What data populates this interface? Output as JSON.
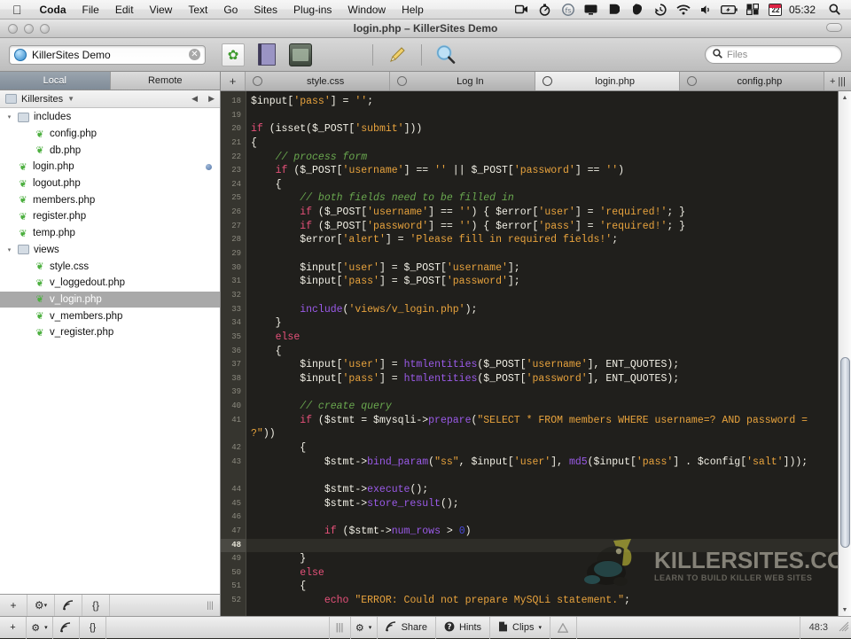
{
  "menubar": {
    "apple_icon": "apple-icon",
    "items": [
      {
        "label": "Coda",
        "bold": true
      },
      {
        "label": "File"
      },
      {
        "label": "Edit"
      },
      {
        "label": "View"
      },
      {
        "label": "Text"
      },
      {
        "label": "Go"
      },
      {
        "label": "Sites"
      },
      {
        "label": "Plug-ins"
      },
      {
        "label": "Window"
      },
      {
        "label": "Help"
      }
    ],
    "status_icons": [
      "screen-record-icon",
      "stopwatch-icon",
      "fastscripts-icon",
      "display-icon",
      "dropbox-icon",
      "evernote-icon",
      "time-machine-icon",
      "wifi-icon",
      "volume-icon",
      "battery-icon",
      "cloud-sync-icon"
    ],
    "date_badge": "22",
    "clock": "05:32",
    "spotlight_icon": "search-icon"
  },
  "window": {
    "title": "login.php – KillerSites Demo"
  },
  "toolbar": {
    "site_name": "KillerSites Demo",
    "clear_glyph": "✕",
    "icons": [
      "leaf-page-icon",
      "book-icon",
      "terminal-icon",
      "pencil-icon",
      "preview-magnifier-icon"
    ],
    "search_placeholder": "Files",
    "search_value": ""
  },
  "sidebar": {
    "tabs": [
      {
        "label": "Local",
        "active": true
      },
      {
        "label": "Remote",
        "active": false
      }
    ],
    "path_label": "Killersites",
    "nav_back": "◀",
    "nav_forward": "▶",
    "files": [
      {
        "label": "includes",
        "type": "folder",
        "indent": 0,
        "twisty": "▾",
        "selected": false,
        "dot": false
      },
      {
        "label": "config.php",
        "type": "php",
        "indent": 1,
        "twisty": "",
        "selected": false,
        "dot": false
      },
      {
        "label": "db.php",
        "type": "php",
        "indent": 1,
        "twisty": "",
        "selected": false,
        "dot": false
      },
      {
        "label": "login.php",
        "type": "php",
        "indent": 0,
        "twisty": "",
        "selected": false,
        "dot": true
      },
      {
        "label": "logout.php",
        "type": "php",
        "indent": 0,
        "twisty": "",
        "selected": false,
        "dot": false
      },
      {
        "label": "members.php",
        "type": "php",
        "indent": 0,
        "twisty": "",
        "selected": false,
        "dot": false
      },
      {
        "label": "register.php",
        "type": "php",
        "indent": 0,
        "twisty": "",
        "selected": false,
        "dot": false
      },
      {
        "label": "temp.php",
        "type": "php",
        "indent": 0,
        "twisty": "",
        "selected": false,
        "dot": false
      },
      {
        "label": "views",
        "type": "folder",
        "indent": 0,
        "twisty": "▾",
        "selected": false,
        "dot": false
      },
      {
        "label": "style.css",
        "type": "php",
        "indent": 1,
        "twisty": "",
        "selected": false,
        "dot": false
      },
      {
        "label": "v_loggedout.php",
        "type": "php",
        "indent": 1,
        "twisty": "",
        "selected": false,
        "dot": false
      },
      {
        "label": "v_login.php",
        "type": "php",
        "indent": 1,
        "twisty": "",
        "selected": true,
        "dot": false
      },
      {
        "label": "v_members.php",
        "type": "php",
        "indent": 1,
        "twisty": "",
        "selected": false,
        "dot": false
      },
      {
        "label": "v_register.php",
        "type": "php",
        "indent": 1,
        "twisty": "",
        "selected": false,
        "dot": false
      }
    ],
    "bottom_buttons": [
      "add-icon",
      "gear-icon",
      "publish-icon",
      "code-braces-icon"
    ]
  },
  "editor": {
    "new_tab_label": "+",
    "tabs": [
      {
        "label": "style.css",
        "active": false
      },
      {
        "label": "Log In",
        "active": false
      },
      {
        "label": "login.php",
        "active": true
      },
      {
        "label": "config.php",
        "active": false
      }
    ],
    "tab_add_label": "+",
    "tab_list_label": "|||",
    "current_line": 48,
    "lines": [
      {
        "n": 18,
        "tokens": [
          {
            "t": "$input[",
            "c": "var"
          },
          {
            "t": "'pass'",
            "c": "str"
          },
          {
            "t": "] = ",
            "c": "var"
          },
          {
            "t": "''",
            "c": "str"
          },
          {
            "t": ";",
            "c": "var"
          }
        ]
      },
      {
        "n": 19,
        "tokens": []
      },
      {
        "n": 20,
        "tokens": [
          {
            "t": "if",
            "c": "kw"
          },
          {
            "t": " (isset($_POST[",
            "c": "var"
          },
          {
            "t": "'submit'",
            "c": "str"
          },
          {
            "t": "]))",
            "c": "var"
          }
        ]
      },
      {
        "n": 21,
        "tokens": [
          {
            "t": "{",
            "c": "var"
          }
        ]
      },
      {
        "n": 22,
        "tokens": [
          {
            "t": "    // process form",
            "c": "com"
          }
        ]
      },
      {
        "n": 23,
        "tokens": [
          {
            "t": "    ",
            "c": "var"
          },
          {
            "t": "if",
            "c": "kw"
          },
          {
            "t": " ($_POST[",
            "c": "var"
          },
          {
            "t": "'username'",
            "c": "str"
          },
          {
            "t": "] == ",
            "c": "var"
          },
          {
            "t": "''",
            "c": "str"
          },
          {
            "t": " || $_POST[",
            "c": "var"
          },
          {
            "t": "'password'",
            "c": "str"
          },
          {
            "t": "] == ",
            "c": "var"
          },
          {
            "t": "''",
            "c": "str"
          },
          {
            "t": ")",
            "c": "var"
          }
        ]
      },
      {
        "n": 24,
        "tokens": [
          {
            "t": "    {",
            "c": "var"
          }
        ]
      },
      {
        "n": 25,
        "tokens": [
          {
            "t": "        // both fields need to be filled in",
            "c": "com"
          }
        ]
      },
      {
        "n": 26,
        "tokens": [
          {
            "t": "        ",
            "c": "var"
          },
          {
            "t": "if",
            "c": "kw"
          },
          {
            "t": " ($_POST[",
            "c": "var"
          },
          {
            "t": "'username'",
            "c": "str"
          },
          {
            "t": "] == ",
            "c": "var"
          },
          {
            "t": "''",
            "c": "str"
          },
          {
            "t": ") { $error[",
            "c": "var"
          },
          {
            "t": "'user'",
            "c": "str"
          },
          {
            "t": "] = ",
            "c": "var"
          },
          {
            "t": "'required!'",
            "c": "str"
          },
          {
            "t": "; }",
            "c": "var"
          }
        ]
      },
      {
        "n": 27,
        "tokens": [
          {
            "t": "        ",
            "c": "var"
          },
          {
            "t": "if",
            "c": "kw"
          },
          {
            "t": " ($_POST[",
            "c": "var"
          },
          {
            "t": "'password'",
            "c": "str"
          },
          {
            "t": "] == ",
            "c": "var"
          },
          {
            "t": "''",
            "c": "str"
          },
          {
            "t": ") { $error[",
            "c": "var"
          },
          {
            "t": "'pass'",
            "c": "str"
          },
          {
            "t": "] = ",
            "c": "var"
          },
          {
            "t": "'required!'",
            "c": "str"
          },
          {
            "t": "; }",
            "c": "var"
          }
        ]
      },
      {
        "n": 28,
        "tokens": [
          {
            "t": "        $error[",
            "c": "var"
          },
          {
            "t": "'alert'",
            "c": "str"
          },
          {
            "t": "] = ",
            "c": "var"
          },
          {
            "t": "'Please fill in required fields!'",
            "c": "str"
          },
          {
            "t": ";",
            "c": "var"
          }
        ]
      },
      {
        "n": 29,
        "tokens": []
      },
      {
        "n": 30,
        "tokens": [
          {
            "t": "        $input[",
            "c": "var"
          },
          {
            "t": "'user'",
            "c": "str"
          },
          {
            "t": "] = $_POST[",
            "c": "var"
          },
          {
            "t": "'username'",
            "c": "str"
          },
          {
            "t": "];",
            "c": "var"
          }
        ]
      },
      {
        "n": 31,
        "tokens": [
          {
            "t": "        $input[",
            "c": "var"
          },
          {
            "t": "'pass'",
            "c": "str"
          },
          {
            "t": "] = $_POST[",
            "c": "var"
          },
          {
            "t": "'password'",
            "c": "str"
          },
          {
            "t": "];",
            "c": "var"
          }
        ]
      },
      {
        "n": 32,
        "tokens": []
      },
      {
        "n": 33,
        "tokens": [
          {
            "t": "        ",
            "c": "var"
          },
          {
            "t": "include",
            "c": "fn"
          },
          {
            "t": "(",
            "c": "var"
          },
          {
            "t": "'views/v_login.php'",
            "c": "str"
          },
          {
            "t": ");",
            "c": "var"
          }
        ]
      },
      {
        "n": 34,
        "tokens": [
          {
            "t": "    }",
            "c": "var"
          }
        ]
      },
      {
        "n": 35,
        "tokens": [
          {
            "t": "    ",
            "c": "var"
          },
          {
            "t": "else",
            "c": "kw"
          }
        ]
      },
      {
        "n": 36,
        "tokens": [
          {
            "t": "    {",
            "c": "var"
          }
        ]
      },
      {
        "n": 37,
        "tokens": [
          {
            "t": "        $input[",
            "c": "var"
          },
          {
            "t": "'user'",
            "c": "str"
          },
          {
            "t": "] = ",
            "c": "var"
          },
          {
            "t": "htmlentities",
            "c": "fn"
          },
          {
            "t": "($_POST[",
            "c": "var"
          },
          {
            "t": "'username'",
            "c": "str"
          },
          {
            "t": "], ENT_QUOTES);",
            "c": "var"
          }
        ]
      },
      {
        "n": 38,
        "tokens": [
          {
            "t": "        $input[",
            "c": "var"
          },
          {
            "t": "'pass'",
            "c": "str"
          },
          {
            "t": "] = ",
            "c": "var"
          },
          {
            "t": "htmlentities",
            "c": "fn"
          },
          {
            "t": "($_POST[",
            "c": "var"
          },
          {
            "t": "'password'",
            "c": "str"
          },
          {
            "t": "], ENT_QUOTES);",
            "c": "var"
          }
        ]
      },
      {
        "n": 39,
        "tokens": []
      },
      {
        "n": 40,
        "tokens": [
          {
            "t": "        // create query",
            "c": "com"
          }
        ]
      },
      {
        "n": 41,
        "wrap": true,
        "tokens": [
          {
            "t": "        ",
            "c": "var"
          },
          {
            "t": "if",
            "c": "kw"
          },
          {
            "t": " ($stmt = $mysqli->",
            "c": "var"
          },
          {
            "t": "prepare",
            "c": "fn"
          },
          {
            "t": "(",
            "c": "var"
          },
          {
            "t": "\"SELECT * FROM members WHERE username=? AND password = ?\"",
            "c": "str"
          },
          {
            "t": "))",
            "c": "var"
          }
        ]
      },
      {
        "n": 42,
        "tokens": [
          {
            "t": "        {",
            "c": "var"
          }
        ]
      },
      {
        "n": 43,
        "wrap": true,
        "tokens": [
          {
            "t": "            $stmt->",
            "c": "var"
          },
          {
            "t": "bind_param",
            "c": "fn"
          },
          {
            "t": "(",
            "c": "var"
          },
          {
            "t": "\"ss\"",
            "c": "str"
          },
          {
            "t": ", $input[",
            "c": "var"
          },
          {
            "t": "'user'",
            "c": "str"
          },
          {
            "t": "], ",
            "c": "var"
          },
          {
            "t": "md5",
            "c": "fn"
          },
          {
            "t": "($input[",
            "c": "var"
          },
          {
            "t": "'pass'",
            "c": "str"
          },
          {
            "t": "] . $config[",
            "c": "var"
          },
          {
            "t": "'salt'",
            "c": "str"
          },
          {
            "t": "]));",
            "c": "var"
          }
        ]
      },
      {
        "n": 44,
        "tokens": [
          {
            "t": "            $stmt->",
            "c": "var"
          },
          {
            "t": "execute",
            "c": "fn"
          },
          {
            "t": "();",
            "c": "var"
          }
        ]
      },
      {
        "n": 45,
        "tokens": [
          {
            "t": "            $stmt->",
            "c": "var"
          },
          {
            "t": "store_result",
            "c": "fn"
          },
          {
            "t": "();",
            "c": "var"
          }
        ]
      },
      {
        "n": 46,
        "tokens": []
      },
      {
        "n": 47,
        "tokens": [
          {
            "t": "            ",
            "c": "var"
          },
          {
            "t": "if",
            "c": "kw"
          },
          {
            "t": " ($stmt->",
            "c": "var"
          },
          {
            "t": "num_rows",
            "c": "fn"
          },
          {
            "t": " > ",
            "c": "var"
          },
          {
            "t": "0",
            "c": "num"
          },
          {
            "t": ")",
            "c": "var"
          }
        ]
      },
      {
        "n": 48,
        "cur": true,
        "tokens": []
      },
      {
        "n": 49,
        "tokens": [
          {
            "t": "        }",
            "c": "var"
          }
        ]
      },
      {
        "n": 50,
        "tokens": [
          {
            "t": "        ",
            "c": "var"
          },
          {
            "t": "else",
            "c": "kw"
          }
        ]
      },
      {
        "n": 51,
        "tokens": [
          {
            "t": "        {",
            "c": "var"
          }
        ]
      },
      {
        "n": 52,
        "tokens": [
          {
            "t": "            ",
            "c": "var"
          },
          {
            "t": "echo",
            "c": "kw"
          },
          {
            "t": " ",
            "c": "var"
          },
          {
            "t": "\"ERROR: Could not prepare MySQLi statement.\"",
            "c": "str"
          },
          {
            "t": ";",
            "c": "var"
          }
        ]
      }
    ]
  },
  "watermark": {
    "title": "KILLERSITES.COM",
    "subtitle": "LEARN TO BUILD KILLER WEB SITES",
    "logo": "frog-logo"
  },
  "statusbar": {
    "gear_label": "",
    "share_label": "Share",
    "hints_label": "Hints",
    "clips_label": "Clips",
    "warning_icon": "warning-icon",
    "cursor_position": "48:3"
  },
  "colors": {
    "editor_bg": "#201f1c",
    "gutter_bg": "#36352f",
    "keyword": "#e6517a",
    "string": "#e8a33d",
    "comment": "#6aa84f",
    "function": "#9a5ae8",
    "number": "#4a4ae0",
    "text": "#f2f0e6",
    "selection": "#a9a9a9"
  }
}
